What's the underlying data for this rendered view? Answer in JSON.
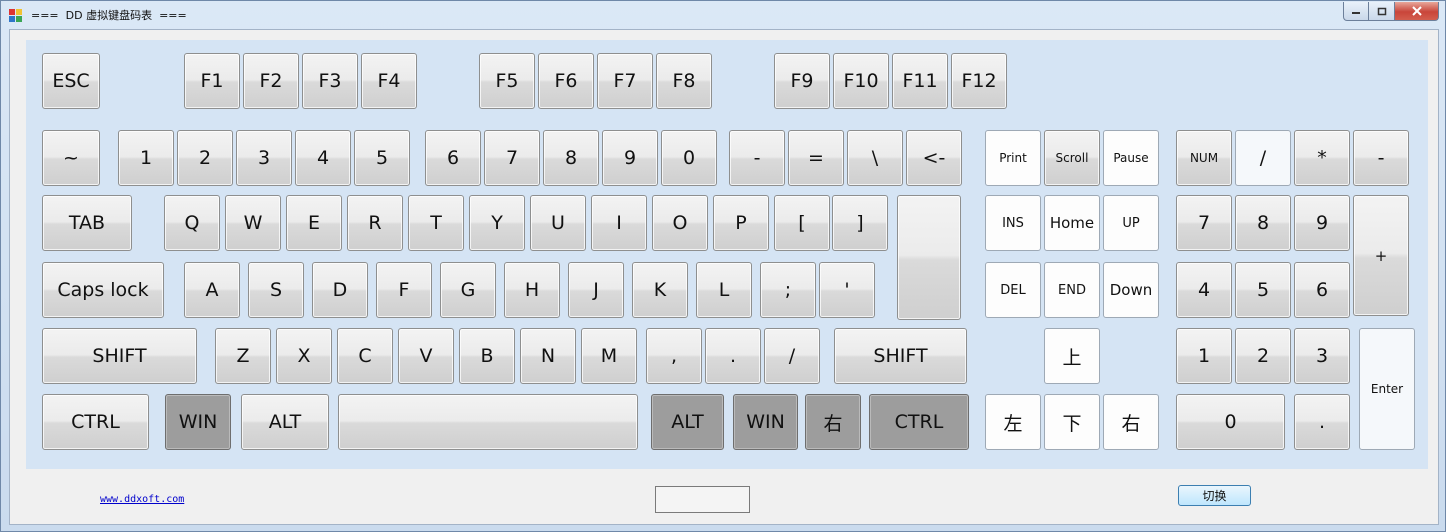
{
  "window": {
    "title": "===  DD 虚拟键盘码表  ===",
    "link_text": "www.ddxoft.com",
    "switch_label": "切换",
    "output_value": ""
  },
  "keys": [
    {
      "id": "esc",
      "label": "ESC"
    },
    {
      "id": "f1",
      "label": "F1"
    },
    {
      "id": "f2",
      "label": "F2"
    },
    {
      "id": "f3",
      "label": "F3"
    },
    {
      "id": "f4",
      "label": "F4"
    },
    {
      "id": "f5",
      "label": "F5"
    },
    {
      "id": "f6",
      "label": "F6"
    },
    {
      "id": "f7",
      "label": "F7"
    },
    {
      "id": "f8",
      "label": "F8"
    },
    {
      "id": "f9",
      "label": "F9"
    },
    {
      "id": "f10",
      "label": "F10"
    },
    {
      "id": "f11",
      "label": "F11"
    },
    {
      "id": "f12",
      "label": "F12"
    },
    {
      "id": "tilde",
      "label": "~"
    },
    {
      "id": "1",
      "label": "1"
    },
    {
      "id": "2",
      "label": "2"
    },
    {
      "id": "3",
      "label": "3"
    },
    {
      "id": "4",
      "label": "4"
    },
    {
      "id": "5",
      "label": "5"
    },
    {
      "id": "6",
      "label": "6"
    },
    {
      "id": "7",
      "label": "7"
    },
    {
      "id": "8",
      "label": "8"
    },
    {
      "id": "9",
      "label": "9"
    },
    {
      "id": "0",
      "label": "0"
    },
    {
      "id": "minus",
      "label": "-"
    },
    {
      "id": "equals",
      "label": "="
    },
    {
      "id": "backslash",
      "label": "\\"
    },
    {
      "id": "backspace",
      "label": "<-"
    },
    {
      "id": "print",
      "label": "Print"
    },
    {
      "id": "scroll",
      "label": "Scroll"
    },
    {
      "id": "pause",
      "label": "Pause"
    },
    {
      "id": "num",
      "label": "NUM"
    },
    {
      "id": "num-divide",
      "label": "/"
    },
    {
      "id": "num-multiply",
      "label": "*"
    },
    {
      "id": "num-minus",
      "label": "-"
    },
    {
      "id": "tab",
      "label": "TAB"
    },
    {
      "id": "q",
      "label": "Q"
    },
    {
      "id": "w",
      "label": "W"
    },
    {
      "id": "e",
      "label": "E"
    },
    {
      "id": "r",
      "label": "R"
    },
    {
      "id": "t",
      "label": "T"
    },
    {
      "id": "y",
      "label": "Y"
    },
    {
      "id": "u",
      "label": "U"
    },
    {
      "id": "i",
      "label": "I"
    },
    {
      "id": "o",
      "label": "O"
    },
    {
      "id": "p",
      "label": "P"
    },
    {
      "id": "lbracket",
      "label": "["
    },
    {
      "id": "rbracket",
      "label": "]"
    },
    {
      "id": "enter-main",
      "label": ""
    },
    {
      "id": "ins",
      "label": "INS"
    },
    {
      "id": "home",
      "label": "Home"
    },
    {
      "id": "up",
      "label": "UP"
    },
    {
      "id": "num7",
      "label": "7"
    },
    {
      "id": "num8",
      "label": "8"
    },
    {
      "id": "num9",
      "label": "9"
    },
    {
      "id": "num-plus",
      "label": "+"
    },
    {
      "id": "caps",
      "label": "Caps lock"
    },
    {
      "id": "a",
      "label": "A"
    },
    {
      "id": "s",
      "label": "S"
    },
    {
      "id": "d",
      "label": "D"
    },
    {
      "id": "f",
      "label": "F"
    },
    {
      "id": "g",
      "label": "G"
    },
    {
      "id": "h",
      "label": "H"
    },
    {
      "id": "j",
      "label": "J"
    },
    {
      "id": "k",
      "label": "K"
    },
    {
      "id": "l",
      "label": "L"
    },
    {
      "id": "semicolon",
      "label": ";"
    },
    {
      "id": "quote",
      "label": "'"
    },
    {
      "id": "del",
      "label": "DEL"
    },
    {
      "id": "end",
      "label": "END"
    },
    {
      "id": "down",
      "label": "Down"
    },
    {
      "id": "num4",
      "label": "4"
    },
    {
      "id": "num5",
      "label": "5"
    },
    {
      "id": "num6",
      "label": "6"
    },
    {
      "id": "lshift",
      "label": "SHIFT"
    },
    {
      "id": "z",
      "label": "Z"
    },
    {
      "id": "x",
      "label": "X"
    },
    {
      "id": "c",
      "label": "C"
    },
    {
      "id": "v",
      "label": "V"
    },
    {
      "id": "b",
      "label": "B"
    },
    {
      "id": "n",
      "label": "N"
    },
    {
      "id": "m",
      "label": "M"
    },
    {
      "id": "comma",
      "label": ","
    },
    {
      "id": "period",
      "label": "."
    },
    {
      "id": "slash",
      "label": "/"
    },
    {
      "id": "rshift",
      "label": "SHIFT"
    },
    {
      "id": "arrow-up",
      "label": "上"
    },
    {
      "id": "num1",
      "label": "1"
    },
    {
      "id": "num2",
      "label": "2"
    },
    {
      "id": "num3",
      "label": "3"
    },
    {
      "id": "num-enter",
      "label": "Enter"
    },
    {
      "id": "lctrl",
      "label": "CTRL"
    },
    {
      "id": "lwin",
      "label": "WIN"
    },
    {
      "id": "lalt",
      "label": "ALT"
    },
    {
      "id": "space",
      "label": ""
    },
    {
      "id": "ralt",
      "label": "ALT"
    },
    {
      "id": "rwin",
      "label": "WIN"
    },
    {
      "id": "menu",
      "label": "右"
    },
    {
      "id": "rctrl",
      "label": "CTRL"
    },
    {
      "id": "arrow-left",
      "label": "左"
    },
    {
      "id": "arrow-down",
      "label": "下"
    },
    {
      "id": "arrow-right",
      "label": "右"
    },
    {
      "id": "num0",
      "label": "0"
    },
    {
      "id": "num-dot",
      "label": "."
    }
  ]
}
